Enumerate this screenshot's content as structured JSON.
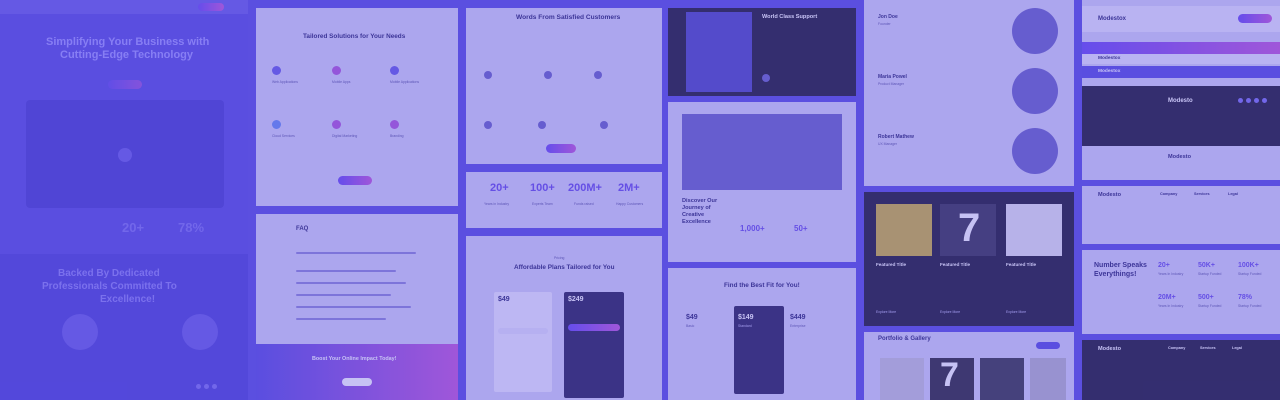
{
  "hero": {
    "title_line1": "Simplifying Your Business with",
    "title_line2": "Cutting-Edge Technology",
    "stat1_num": "20+",
    "stat2_num": "78%",
    "banner_line1": "Backed By Dedicated",
    "banner_line2": "Professionals Committed To",
    "banner_line3": "Excellence!"
  },
  "services": {
    "title": "Tailored Solutions for Your Needs",
    "items": [
      "Web Applications",
      "Mobile Apps",
      "Mobile Applications",
      "Cloud Services",
      "Digital Marketing",
      "Branding"
    ]
  },
  "testimonials": {
    "title": "Words From Satisfied Customers"
  },
  "stats_row": {
    "items": [
      {
        "num": "20+",
        "label": "Years in Industry"
      },
      {
        "num": "100+",
        "label": "Experts Team"
      },
      {
        "num": "200M+",
        "label": "Funds raised"
      },
      {
        "num": "2M+",
        "label": "Happy Customers"
      }
    ]
  },
  "pricing1": {
    "tag": "Pricing",
    "title": "Affordable Plans Tailored for You",
    "price1": "$49",
    "price2": "$249"
  },
  "faq": {
    "title": "FAQ",
    "cta": "Boost Your Online Impact Today!"
  },
  "support": {
    "title": "World Class Support",
    "discover_line1": "Discover Our",
    "discover_line2": "Journey of",
    "discover_line3": "Creative",
    "discover_line4": "Excellence",
    "num1": "1,000+",
    "num2": "50+"
  },
  "pricing2": {
    "title": "Find the Best Fit for You!",
    "price1": "$49",
    "price2": "$149",
    "price3": "$449",
    "plan1": "Basic",
    "plan2": "Standard",
    "plan3": "Enterprise"
  },
  "team": {
    "members": [
      {
        "name": "Jon Doe",
        "role": "Founder"
      },
      {
        "name": "Maria Powel",
        "role": "Product Manager"
      },
      {
        "name": "Robert Mathew",
        "role": "UX Manager"
      }
    ]
  },
  "features": {
    "items": [
      {
        "title": "Featured Title",
        "more": "Explore More"
      },
      {
        "title": "Featured Title",
        "more": "Explore More"
      },
      {
        "title": "Featured Title",
        "more": "Explore More"
      }
    ]
  },
  "portfolio": {
    "title": "Portfolio & Gallery"
  },
  "headers": {
    "brand": "Modestox",
    "brand2": "Modesto",
    "footer_cols": [
      "Company",
      "Services",
      "Legal"
    ]
  },
  "numbers": {
    "title_line1": "Number Speaks",
    "title_line2": "Everythings!",
    "items": [
      {
        "num": "20+",
        "label": "Years In Industry"
      },
      {
        "num": "50K+",
        "label": "Startup Funded"
      },
      {
        "num": "100K+",
        "label": "Startup Funded"
      },
      {
        "num": "20M+",
        "label": "Years In Industry"
      },
      {
        "num": "500+",
        "label": "Startup Funded"
      },
      {
        "num": "78%",
        "label": "Startup Funded"
      }
    ]
  },
  "colors": {
    "accent": "#5b4fe0",
    "dark": "#1f1c34",
    "gradient_end": "#c45ad6"
  }
}
